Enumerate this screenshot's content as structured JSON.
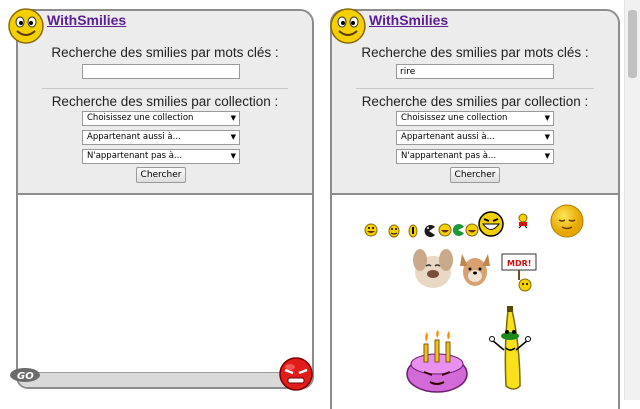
{
  "left": {
    "title": "WithSmilies",
    "keywords_label": "Recherche des smilies par mots clés :",
    "keyword_value": "",
    "collection_label": "Recherche des smilies par collection :",
    "selects": [
      "Choisissez une collection",
      "Appartenant aussi à...",
      "N'appartenant pas à..."
    ],
    "search_button": "Chercher",
    "footer_logo_text": "GO"
  },
  "right": {
    "title": "WithSmilies",
    "keywords_label": "Recherche des smilies par mots clés :",
    "keyword_value": "rire",
    "collection_label": "Recherche des smilies par collection :",
    "selects": [
      "Choisissez une collection",
      "Appartenant aussi à...",
      "N'appartenant pas à..."
    ],
    "search_button": "Chercher",
    "sign_text": "MDR!"
  },
  "colors": {
    "accent": "#5a1e96",
    "smiley": "#f5d000",
    "panel": "#ececec",
    "border": "#8c8c8c"
  }
}
